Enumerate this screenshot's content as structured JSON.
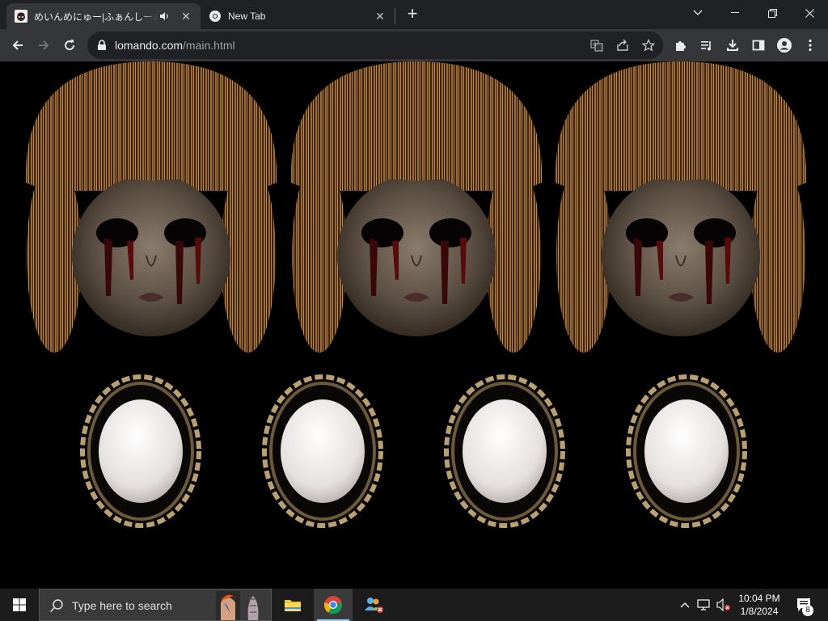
{
  "tabs": [
    {
      "title": "めいんめにゅー|ふぁんしーあいら人",
      "active": true,
      "audio": true
    },
    {
      "title": "New Tab",
      "active": false
    }
  ],
  "address_bar": {
    "domain": "lomando.com",
    "path": "/main.html"
  },
  "taskbar": {
    "search_placeholder": "Type here to search",
    "time": "10:04 PM",
    "date": "1/8/2024",
    "notification_count": "8"
  },
  "colors": {
    "tab_strip": "#202124",
    "toolbar": "#35363a",
    "page_bg": "#000000",
    "taskbar": "#1c1c1c"
  },
  "page_content": {
    "doll_count": 3,
    "mirror_count": 4
  }
}
